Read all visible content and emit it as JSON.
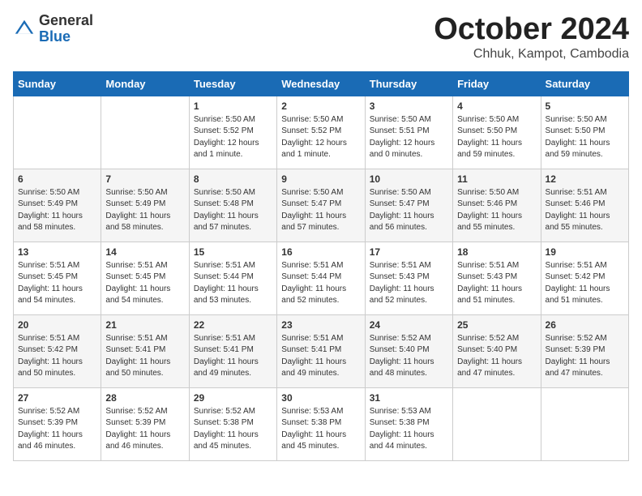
{
  "logo": {
    "general": "General",
    "blue": "Blue"
  },
  "header": {
    "month": "October 2024",
    "location": "Chhuk, Kampot, Cambodia"
  },
  "weekdays": [
    "Sunday",
    "Monday",
    "Tuesday",
    "Wednesday",
    "Thursday",
    "Friday",
    "Saturday"
  ],
  "weeks": [
    [
      {
        "day": "",
        "info": ""
      },
      {
        "day": "",
        "info": ""
      },
      {
        "day": "1",
        "info": "Sunrise: 5:50 AM\nSunset: 5:52 PM\nDaylight: 12 hours and 1 minute."
      },
      {
        "day": "2",
        "info": "Sunrise: 5:50 AM\nSunset: 5:52 PM\nDaylight: 12 hours and 1 minute."
      },
      {
        "day": "3",
        "info": "Sunrise: 5:50 AM\nSunset: 5:51 PM\nDaylight: 12 hours and 0 minutes."
      },
      {
        "day": "4",
        "info": "Sunrise: 5:50 AM\nSunset: 5:50 PM\nDaylight: 11 hours and 59 minutes."
      },
      {
        "day": "5",
        "info": "Sunrise: 5:50 AM\nSunset: 5:50 PM\nDaylight: 11 hours and 59 minutes."
      }
    ],
    [
      {
        "day": "6",
        "info": "Sunrise: 5:50 AM\nSunset: 5:49 PM\nDaylight: 11 hours and 58 minutes."
      },
      {
        "day": "7",
        "info": "Sunrise: 5:50 AM\nSunset: 5:49 PM\nDaylight: 11 hours and 58 minutes."
      },
      {
        "day": "8",
        "info": "Sunrise: 5:50 AM\nSunset: 5:48 PM\nDaylight: 11 hours and 57 minutes."
      },
      {
        "day": "9",
        "info": "Sunrise: 5:50 AM\nSunset: 5:47 PM\nDaylight: 11 hours and 57 minutes."
      },
      {
        "day": "10",
        "info": "Sunrise: 5:50 AM\nSunset: 5:47 PM\nDaylight: 11 hours and 56 minutes."
      },
      {
        "day": "11",
        "info": "Sunrise: 5:50 AM\nSunset: 5:46 PM\nDaylight: 11 hours and 55 minutes."
      },
      {
        "day": "12",
        "info": "Sunrise: 5:51 AM\nSunset: 5:46 PM\nDaylight: 11 hours and 55 minutes."
      }
    ],
    [
      {
        "day": "13",
        "info": "Sunrise: 5:51 AM\nSunset: 5:45 PM\nDaylight: 11 hours and 54 minutes."
      },
      {
        "day": "14",
        "info": "Sunrise: 5:51 AM\nSunset: 5:45 PM\nDaylight: 11 hours and 54 minutes."
      },
      {
        "day": "15",
        "info": "Sunrise: 5:51 AM\nSunset: 5:44 PM\nDaylight: 11 hours and 53 minutes."
      },
      {
        "day": "16",
        "info": "Sunrise: 5:51 AM\nSunset: 5:44 PM\nDaylight: 11 hours and 52 minutes."
      },
      {
        "day": "17",
        "info": "Sunrise: 5:51 AM\nSunset: 5:43 PM\nDaylight: 11 hours and 52 minutes."
      },
      {
        "day": "18",
        "info": "Sunrise: 5:51 AM\nSunset: 5:43 PM\nDaylight: 11 hours and 51 minutes."
      },
      {
        "day": "19",
        "info": "Sunrise: 5:51 AM\nSunset: 5:42 PM\nDaylight: 11 hours and 51 minutes."
      }
    ],
    [
      {
        "day": "20",
        "info": "Sunrise: 5:51 AM\nSunset: 5:42 PM\nDaylight: 11 hours and 50 minutes."
      },
      {
        "day": "21",
        "info": "Sunrise: 5:51 AM\nSunset: 5:41 PM\nDaylight: 11 hours and 50 minutes."
      },
      {
        "day": "22",
        "info": "Sunrise: 5:51 AM\nSunset: 5:41 PM\nDaylight: 11 hours and 49 minutes."
      },
      {
        "day": "23",
        "info": "Sunrise: 5:51 AM\nSunset: 5:41 PM\nDaylight: 11 hours and 49 minutes."
      },
      {
        "day": "24",
        "info": "Sunrise: 5:52 AM\nSunset: 5:40 PM\nDaylight: 11 hours and 48 minutes."
      },
      {
        "day": "25",
        "info": "Sunrise: 5:52 AM\nSunset: 5:40 PM\nDaylight: 11 hours and 47 minutes."
      },
      {
        "day": "26",
        "info": "Sunrise: 5:52 AM\nSunset: 5:39 PM\nDaylight: 11 hours and 47 minutes."
      }
    ],
    [
      {
        "day": "27",
        "info": "Sunrise: 5:52 AM\nSunset: 5:39 PM\nDaylight: 11 hours and 46 minutes."
      },
      {
        "day": "28",
        "info": "Sunrise: 5:52 AM\nSunset: 5:39 PM\nDaylight: 11 hours and 46 minutes."
      },
      {
        "day": "29",
        "info": "Sunrise: 5:52 AM\nSunset: 5:38 PM\nDaylight: 11 hours and 45 minutes."
      },
      {
        "day": "30",
        "info": "Sunrise: 5:53 AM\nSunset: 5:38 PM\nDaylight: 11 hours and 45 minutes."
      },
      {
        "day": "31",
        "info": "Sunrise: 5:53 AM\nSunset: 5:38 PM\nDaylight: 11 hours and 44 minutes."
      },
      {
        "day": "",
        "info": ""
      },
      {
        "day": "",
        "info": ""
      }
    ]
  ]
}
